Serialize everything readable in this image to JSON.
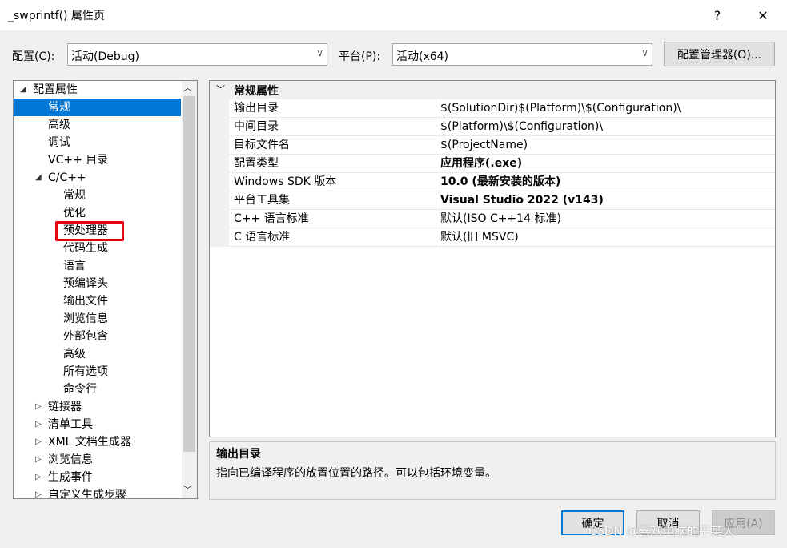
{
  "window": {
    "title": "_swprintf() 属性页",
    "help_glyph": "?",
    "close_glyph": "✕"
  },
  "config": {
    "config_label": "配置(C):",
    "config_value": "活动(Debug)",
    "platform_label": "平台(P):",
    "platform_value": "活动(x64)",
    "manager_button": "配置管理器(O)..."
  },
  "tree": {
    "items": [
      {
        "label": "配置属性",
        "expander": "◢"
      },
      {
        "label": "常规"
      },
      {
        "label": "高级"
      },
      {
        "label": "调试"
      },
      {
        "label": "VC++ 目录"
      },
      {
        "label": "C/C++",
        "expander": "◢"
      },
      {
        "label": "常规"
      },
      {
        "label": "优化"
      },
      {
        "label": "预处理器"
      },
      {
        "label": "代码生成"
      },
      {
        "label": "语言"
      },
      {
        "label": "预编译头"
      },
      {
        "label": "输出文件"
      },
      {
        "label": "浏览信息"
      },
      {
        "label": "外部包含"
      },
      {
        "label": "高级"
      },
      {
        "label": "所有选项"
      },
      {
        "label": "命令行"
      },
      {
        "label": "链接器",
        "expander": "▷"
      },
      {
        "label": "清单工具",
        "expander": "▷"
      },
      {
        "label": "XML 文档生成器",
        "expander": "▷"
      },
      {
        "label": "浏览信息",
        "expander": "▷"
      },
      {
        "label": "生成事件",
        "expander": "▷"
      },
      {
        "label": "自定义生成步骤",
        "expander": "▷"
      }
    ],
    "scroll_up": "︿",
    "scroll_down": "﹀"
  },
  "grid": {
    "section_title": "常规属性",
    "section_expander": "﹀",
    "rows": [
      {
        "key": "输出目录",
        "value": "$(SolutionDir)$(Platform)\\$(Configuration)\\"
      },
      {
        "key": "中间目录",
        "value": "$(Platform)\\$(Configuration)\\"
      },
      {
        "key": "目标文件名",
        "value": "$(ProjectName)"
      },
      {
        "key": "配置类型",
        "value": "应用程序(.exe)"
      },
      {
        "key": "Windows SDK 版本",
        "value": "10.0 (最新安装的版本)"
      },
      {
        "key": "平台工具集",
        "value": "Visual Studio 2022 (v143)"
      },
      {
        "key": "C++ 语言标准",
        "value": "默认(ISO C++14 标准)"
      },
      {
        "key": "C 语言标准",
        "value": "默认(旧 MSVC)"
      }
    ]
  },
  "description": {
    "title": "输出目录",
    "text": "指向已编译程序的放置位置的路径。可以包括环境变量。"
  },
  "buttons": {
    "ok": "确定",
    "cancel": "取消",
    "apply": "应用(A)"
  },
  "watermark": "CSDN @喜欢电脑的平某人",
  "colors": {
    "selection": "#0078d7",
    "highlight_box": "#e8000c",
    "ok_border": "#0078d7"
  }
}
